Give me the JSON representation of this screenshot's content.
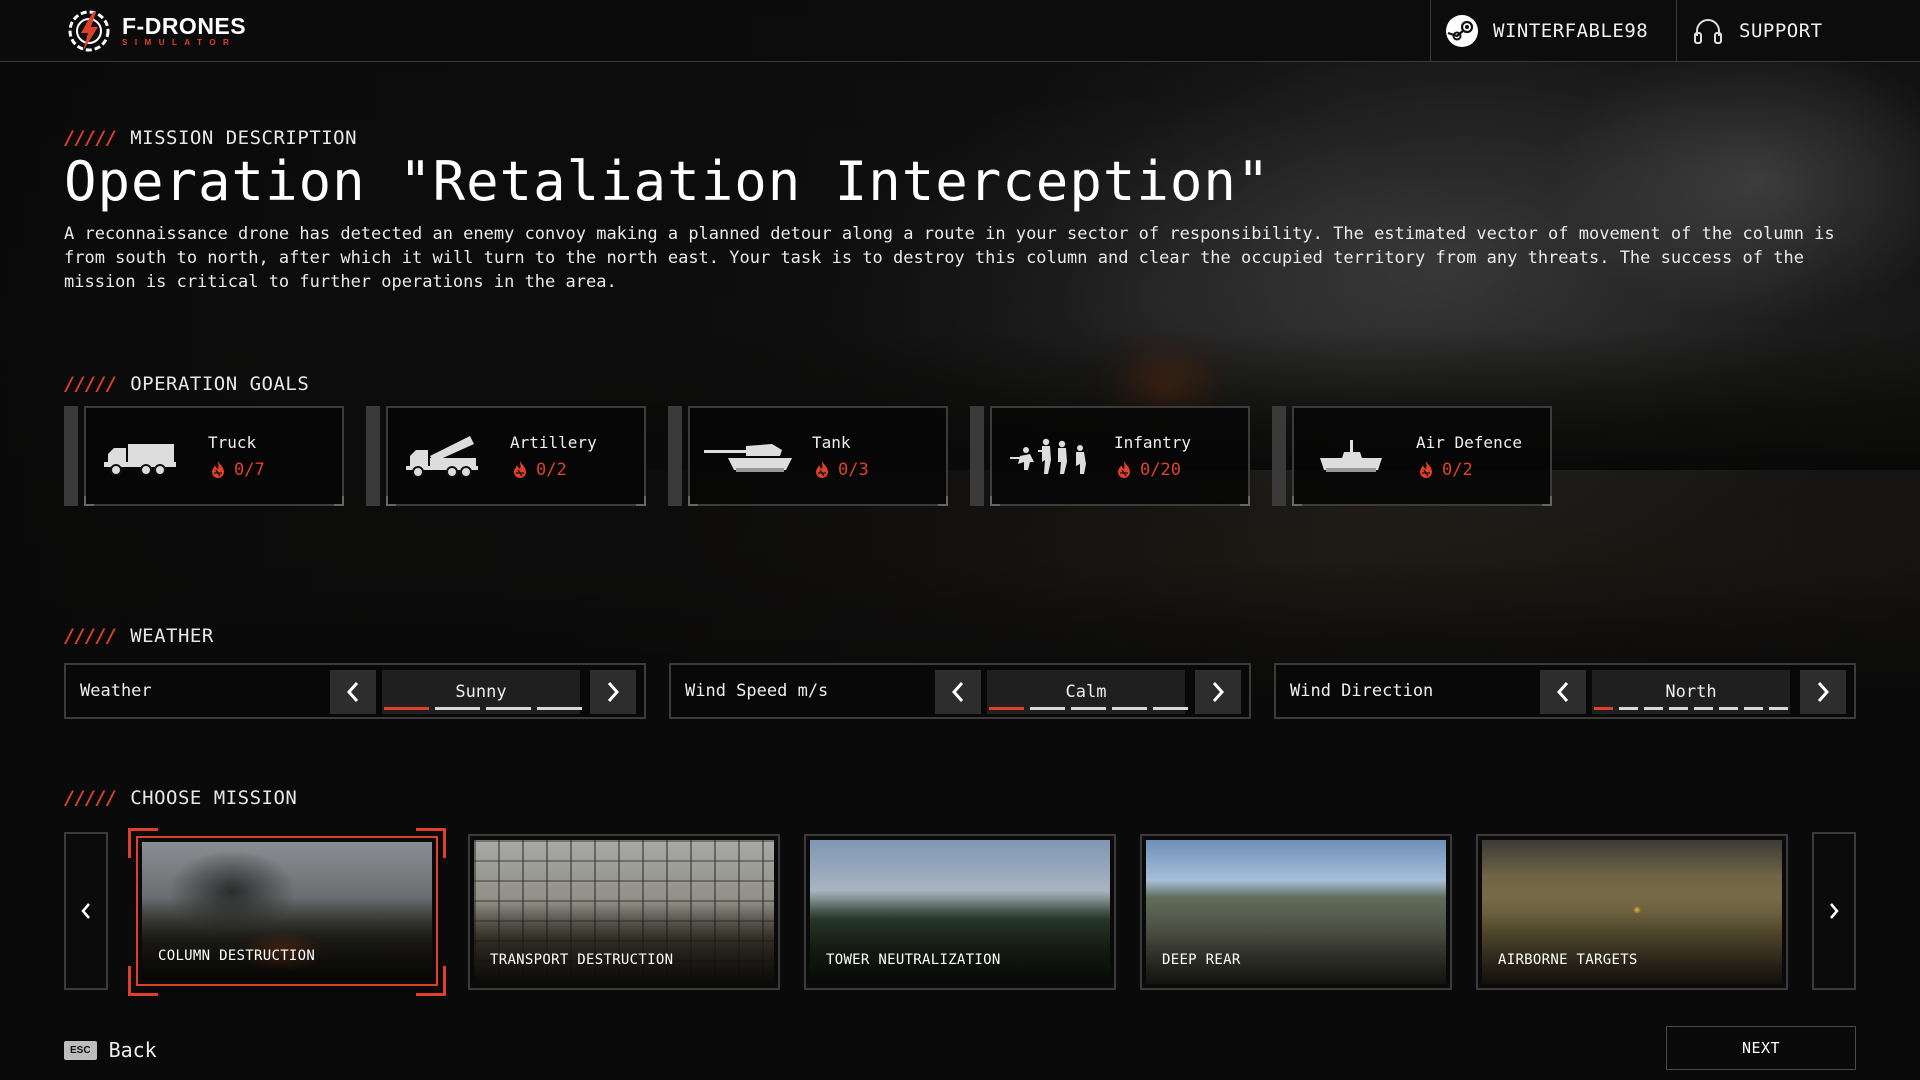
{
  "header": {
    "brand": "F-DRONES",
    "brand_sub": "SIMULATOR",
    "username": "WINTERFABLE98",
    "support_label": "SUPPORT"
  },
  "mission_description": {
    "section_title": "MISSION DESCRIPTION",
    "title": "Operation \"Retaliation Interception\"",
    "text": "A reconnaissance drone has detected an enemy convoy making a planned detour along a route in your sector of responsibility. The estimated vector of movement of the column is from south to north, after which it will turn to the north east. Your task is to destroy this column and clear the occupied territory from any threats. The success of the mission is critical to further operations in the area."
  },
  "goals": {
    "section_title": "OPERATION GOALS",
    "items": [
      {
        "name": "Truck",
        "count": "0/7",
        "icon": "truck-icon"
      },
      {
        "name": "Artillery",
        "count": "0/2",
        "icon": "artillery-icon"
      },
      {
        "name": "Tank",
        "count": "0/3",
        "icon": "tank-icon"
      },
      {
        "name": "Infantry",
        "count": "0/20",
        "icon": "infantry-icon"
      },
      {
        "name": "Air Defence",
        "count": "0/2",
        "icon": "air-defence-icon"
      }
    ]
  },
  "weather": {
    "section_title": "WEATHER",
    "selectors": [
      {
        "label": "Weather",
        "value": "Sunny",
        "options_count": 4,
        "selected_index": 0
      },
      {
        "label": "Wind Speed m/s",
        "value": "Calm",
        "options_count": 5,
        "selected_index": 0
      },
      {
        "label": "Wind Direction",
        "value": "North",
        "options_count": 8,
        "selected_index": 0
      }
    ]
  },
  "missions": {
    "section_title": "CHOOSE MISSION",
    "items": [
      {
        "label": "COLUMN DESTRUCTION",
        "selected": true
      },
      {
        "label": "TRANSPORT DESTRUCTION",
        "selected": false
      },
      {
        "label": "TOWER NEUTRALIZATION",
        "selected": false
      },
      {
        "label": "DEEP REAR",
        "selected": false
      },
      {
        "label": "AIRBORNE TARGETS",
        "selected": false
      }
    ]
  },
  "footer": {
    "esc_key": "ESC",
    "back_label": "Back",
    "next_label": "NEXT"
  },
  "colors": {
    "accent": "#e0402a",
    "background": "#0a0a0a"
  }
}
